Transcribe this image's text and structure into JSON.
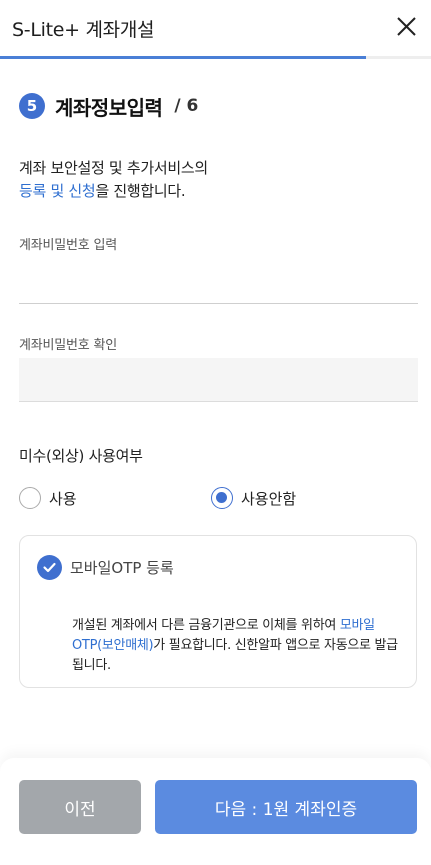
{
  "header": {
    "title": "S-Lite+ 계좌개설",
    "close_icon": "close-icon",
    "progress_fraction": 0.85
  },
  "step": {
    "number": "5",
    "title": "계좌정보입력",
    "total": "/ 6"
  },
  "description": {
    "line1": "계좌 보안설정 및 추가서비스의",
    "link": "등록 및 신청",
    "line2_rest": "을 진행합니다."
  },
  "fields": {
    "password_label": "계좌비밀번호 입력",
    "password_value": "",
    "password_confirm_label": "계좌비밀번호 확인",
    "password_confirm_value": ""
  },
  "margin_usage": {
    "title": "미수(외상) 사용여부",
    "options": [
      {
        "label": "사용",
        "selected": false
      },
      {
        "label": "사용안함",
        "selected": true
      }
    ]
  },
  "otp": {
    "title": "모바일OTP 등록",
    "checked": true,
    "desc_part1": "개설된 계좌에서 다른 금융기관으로 이체를 위하여 ",
    "desc_link": "모바일 OTP(보안매체)",
    "desc_part2": "가 필요합니다. 신한알파 앱으로 자동으로 발급됩니다."
  },
  "buttons": {
    "prev": "이전",
    "next": "다음 : 1원 계좌인증"
  },
  "colors": {
    "accent": "#3f6fcf",
    "link": "#2f6fd0",
    "next_button": "#5b8be0",
    "prev_button": "#a3a7ab"
  }
}
